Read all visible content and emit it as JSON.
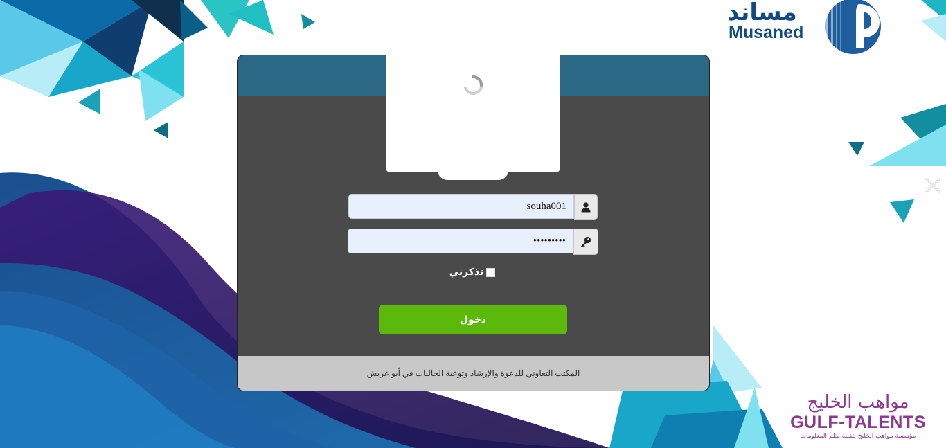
{
  "brand": {
    "musaned_arabic": "مساند",
    "musaned_english": "Musaned",
    "gulf_talents_arabic": "مواهب الخليج",
    "gulf_talents_english": "GULF-TALENTS",
    "gulf_talents_tagline": "مؤسسة مواهب الخليج لتقنية نظم المعلومات"
  },
  "login_form": {
    "username_value": "souha001",
    "password_value": "•••••••••",
    "remember_label": "تذكرني",
    "remember_checked": false,
    "submit_label": "دخول"
  },
  "footer": {
    "text": "المكتب التعاوني للدعوة والإرشاد وتوعية الجاليات في أبو عريش"
  },
  "icons": {
    "username": "user-icon",
    "password": "key-icon",
    "loading": "spinner-icon",
    "close": "close-icon"
  },
  "colors": {
    "header": "#2a6886",
    "body": "#4a4a4a",
    "footer": "#c8c8c8",
    "button": "#5cb80a",
    "brand_blue": "#0f4a82",
    "brand_purple": "#8b3a8f"
  }
}
